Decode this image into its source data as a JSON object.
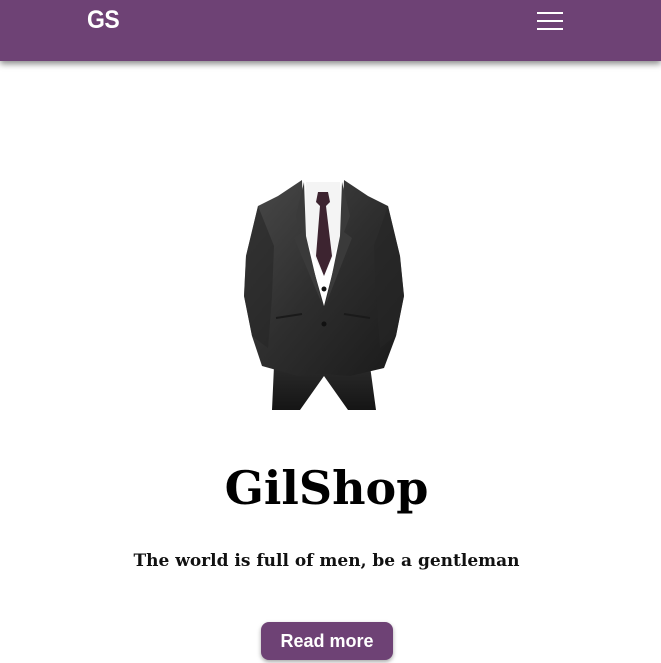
{
  "navbar": {
    "brand": "GS",
    "menu_icon": "hamburger-menu-icon",
    "background_color": "#6e4275"
  },
  "hero": {
    "image": "suit-image",
    "title": "GilShop",
    "tagline": "The world is full of men, be a gentleman",
    "button_label": "Read more",
    "button_color": "#6e4275"
  }
}
